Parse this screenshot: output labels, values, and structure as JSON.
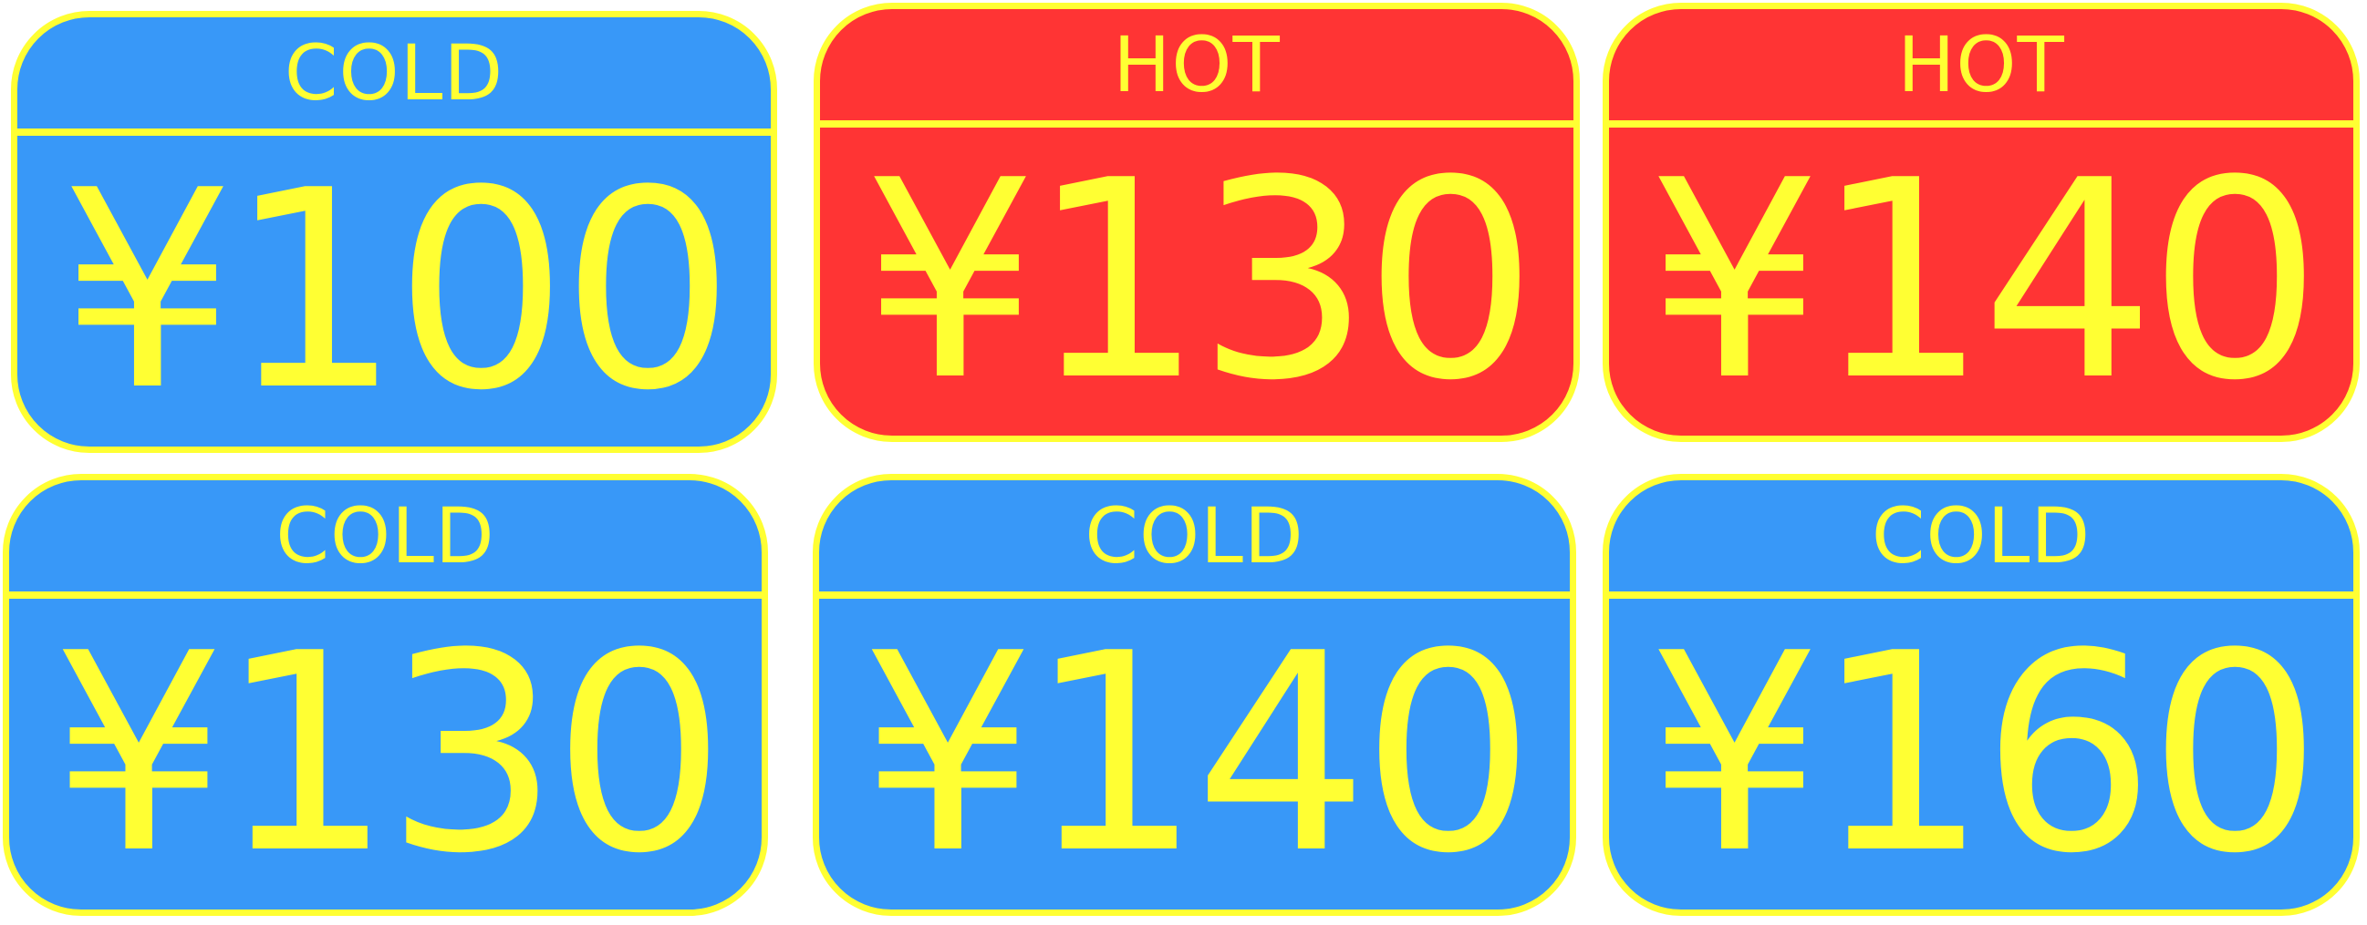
{
  "labels": [
    {
      "type": "cold",
      "header": "COLD",
      "price": "¥100"
    },
    {
      "type": "hot",
      "header": "HOT",
      "price": "¥130"
    },
    {
      "type": "hot",
      "header": "HOT",
      "price": "¥140"
    },
    {
      "type": "cold",
      "header": "COLD",
      "price": "¥130"
    },
    {
      "type": "cold",
      "header": "COLD",
      "price": "¥140"
    },
    {
      "type": "cold",
      "header": "COLD",
      "price": "¥160"
    }
  ],
  "colors": {
    "cold_background": "#3898f8",
    "hot_background": "#ff3434",
    "text_and_border": "#ffff33"
  }
}
